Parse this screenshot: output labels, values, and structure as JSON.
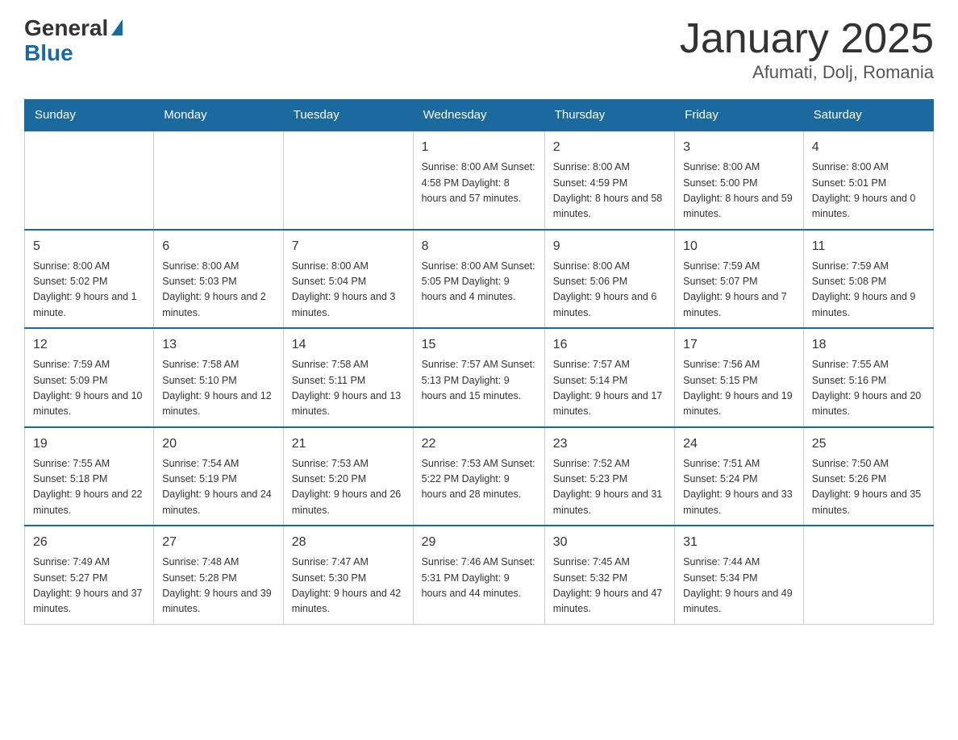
{
  "logo": {
    "general": "General",
    "blue": "Blue"
  },
  "title": "January 2025",
  "subtitle": "Afumati, Dolj, Romania",
  "days_of_week": [
    "Sunday",
    "Monday",
    "Tuesday",
    "Wednesday",
    "Thursday",
    "Friday",
    "Saturday"
  ],
  "weeks": [
    [
      {
        "day": "",
        "info": ""
      },
      {
        "day": "",
        "info": ""
      },
      {
        "day": "",
        "info": ""
      },
      {
        "day": "1",
        "info": "Sunrise: 8:00 AM\nSunset: 4:58 PM\nDaylight: 8 hours\nand 57 minutes."
      },
      {
        "day": "2",
        "info": "Sunrise: 8:00 AM\nSunset: 4:59 PM\nDaylight: 8 hours\nand 58 minutes."
      },
      {
        "day": "3",
        "info": "Sunrise: 8:00 AM\nSunset: 5:00 PM\nDaylight: 8 hours\nand 59 minutes."
      },
      {
        "day": "4",
        "info": "Sunrise: 8:00 AM\nSunset: 5:01 PM\nDaylight: 9 hours\nand 0 minutes."
      }
    ],
    [
      {
        "day": "5",
        "info": "Sunrise: 8:00 AM\nSunset: 5:02 PM\nDaylight: 9 hours\nand 1 minute."
      },
      {
        "day": "6",
        "info": "Sunrise: 8:00 AM\nSunset: 5:03 PM\nDaylight: 9 hours\nand 2 minutes."
      },
      {
        "day": "7",
        "info": "Sunrise: 8:00 AM\nSunset: 5:04 PM\nDaylight: 9 hours\nand 3 minutes."
      },
      {
        "day": "8",
        "info": "Sunrise: 8:00 AM\nSunset: 5:05 PM\nDaylight: 9 hours\nand 4 minutes."
      },
      {
        "day": "9",
        "info": "Sunrise: 8:00 AM\nSunset: 5:06 PM\nDaylight: 9 hours\nand 6 minutes."
      },
      {
        "day": "10",
        "info": "Sunrise: 7:59 AM\nSunset: 5:07 PM\nDaylight: 9 hours\nand 7 minutes."
      },
      {
        "day": "11",
        "info": "Sunrise: 7:59 AM\nSunset: 5:08 PM\nDaylight: 9 hours\nand 9 minutes."
      }
    ],
    [
      {
        "day": "12",
        "info": "Sunrise: 7:59 AM\nSunset: 5:09 PM\nDaylight: 9 hours\nand 10 minutes."
      },
      {
        "day": "13",
        "info": "Sunrise: 7:58 AM\nSunset: 5:10 PM\nDaylight: 9 hours\nand 12 minutes."
      },
      {
        "day": "14",
        "info": "Sunrise: 7:58 AM\nSunset: 5:11 PM\nDaylight: 9 hours\nand 13 minutes."
      },
      {
        "day": "15",
        "info": "Sunrise: 7:57 AM\nSunset: 5:13 PM\nDaylight: 9 hours\nand 15 minutes."
      },
      {
        "day": "16",
        "info": "Sunrise: 7:57 AM\nSunset: 5:14 PM\nDaylight: 9 hours\nand 17 minutes."
      },
      {
        "day": "17",
        "info": "Sunrise: 7:56 AM\nSunset: 5:15 PM\nDaylight: 9 hours\nand 19 minutes."
      },
      {
        "day": "18",
        "info": "Sunrise: 7:55 AM\nSunset: 5:16 PM\nDaylight: 9 hours\nand 20 minutes."
      }
    ],
    [
      {
        "day": "19",
        "info": "Sunrise: 7:55 AM\nSunset: 5:18 PM\nDaylight: 9 hours\nand 22 minutes."
      },
      {
        "day": "20",
        "info": "Sunrise: 7:54 AM\nSunset: 5:19 PM\nDaylight: 9 hours\nand 24 minutes."
      },
      {
        "day": "21",
        "info": "Sunrise: 7:53 AM\nSunset: 5:20 PM\nDaylight: 9 hours\nand 26 minutes."
      },
      {
        "day": "22",
        "info": "Sunrise: 7:53 AM\nSunset: 5:22 PM\nDaylight: 9 hours\nand 28 minutes."
      },
      {
        "day": "23",
        "info": "Sunrise: 7:52 AM\nSunset: 5:23 PM\nDaylight: 9 hours\nand 31 minutes."
      },
      {
        "day": "24",
        "info": "Sunrise: 7:51 AM\nSunset: 5:24 PM\nDaylight: 9 hours\nand 33 minutes."
      },
      {
        "day": "25",
        "info": "Sunrise: 7:50 AM\nSunset: 5:26 PM\nDaylight: 9 hours\nand 35 minutes."
      }
    ],
    [
      {
        "day": "26",
        "info": "Sunrise: 7:49 AM\nSunset: 5:27 PM\nDaylight: 9 hours\nand 37 minutes."
      },
      {
        "day": "27",
        "info": "Sunrise: 7:48 AM\nSunset: 5:28 PM\nDaylight: 9 hours\nand 39 minutes."
      },
      {
        "day": "28",
        "info": "Sunrise: 7:47 AM\nSunset: 5:30 PM\nDaylight: 9 hours\nand 42 minutes."
      },
      {
        "day": "29",
        "info": "Sunrise: 7:46 AM\nSunset: 5:31 PM\nDaylight: 9 hours\nand 44 minutes."
      },
      {
        "day": "30",
        "info": "Sunrise: 7:45 AM\nSunset: 5:32 PM\nDaylight: 9 hours\nand 47 minutes."
      },
      {
        "day": "31",
        "info": "Sunrise: 7:44 AM\nSunset: 5:34 PM\nDaylight: 9 hours\nand 49 minutes."
      },
      {
        "day": "",
        "info": ""
      }
    ]
  ]
}
